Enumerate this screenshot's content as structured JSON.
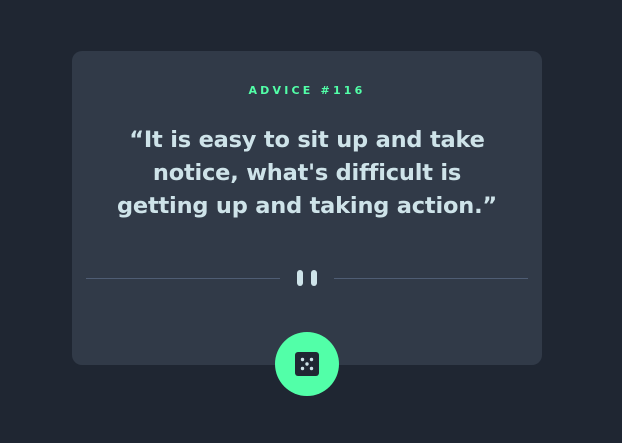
{
  "advice": {
    "label": "ADVICE #116",
    "quote": "“It is easy to sit up and take notice, what's difficult is getting up and taking action.”"
  },
  "colors": {
    "background": "#1f2632",
    "card": "#313a48",
    "accent": "#52ffa8",
    "quote_text": "#cee3e9",
    "divider": "#4f5d74"
  },
  "icons": {
    "divider": "pause-icon",
    "button": "dice-icon"
  }
}
